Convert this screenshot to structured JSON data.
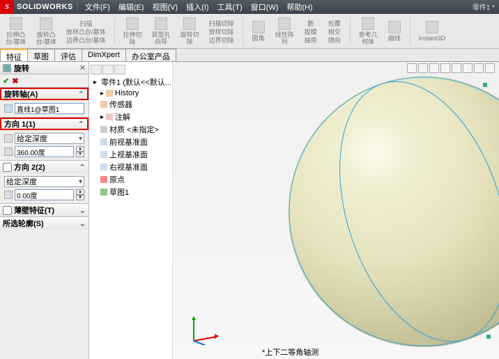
{
  "brand": "SOLIDWORKS",
  "doc_label": "零件1 *",
  "menu": [
    "文件(F)",
    "编辑(E)",
    "视图(V)",
    "插入(I)",
    "工具(T)",
    "窗口(W)",
    "帮助(H)"
  ],
  "ribbon": {
    "items": [
      {
        "label": "拉伸凸\n台/基体"
      },
      {
        "label": "旋转凸\n台/基体"
      },
      {
        "label": "扫描"
      },
      {
        "label": "放样凸台/基体"
      },
      {
        "label": "边界凸台/基体"
      },
      {
        "label": "拉伸切\n除"
      },
      {
        "label": "异型孔\n向导"
      },
      {
        "label": "旋转切\n除"
      },
      {
        "label": "扫描切除"
      },
      {
        "label": "放样切除"
      },
      {
        "label": "边界切除"
      },
      {
        "label": "圆角"
      },
      {
        "label": "线性阵\n列"
      },
      {
        "label": "筋"
      },
      {
        "label": "拔模"
      },
      {
        "label": "抽壳"
      },
      {
        "label": "包覆"
      },
      {
        "label": "相交"
      },
      {
        "label": "镜向"
      },
      {
        "label": "参考几\n何体"
      },
      {
        "label": "曲线"
      },
      {
        "label": "Instant3D"
      }
    ]
  },
  "tabs": [
    "特征",
    "草图",
    "评估",
    "DimXpert",
    "办公室产品"
  ],
  "active_tab_index": 0,
  "pm": {
    "title": "旋转",
    "sections": {
      "axis": {
        "title": "旋转轴(A)",
        "value": "直线1@草图1"
      },
      "dir1": {
        "title": "方向 1(1)",
        "type": "给定深度",
        "angle": "360.00度"
      },
      "dir2": {
        "title": "方向 2(2)",
        "type": "给定深度",
        "angle": "0.00度"
      },
      "thin": {
        "title": "薄壁特征(T)"
      },
      "sel": {
        "title": "所选轮廓(S)"
      }
    }
  },
  "tree": {
    "root": "零件1 (默认<<默认...",
    "items": [
      "History",
      "传感器",
      "注解",
      "材质 <未指定>",
      "前视基准面",
      "上视基准面",
      "右视基准面",
      "原点",
      "草图1"
    ]
  },
  "status_text": "*上下二等角轴测"
}
